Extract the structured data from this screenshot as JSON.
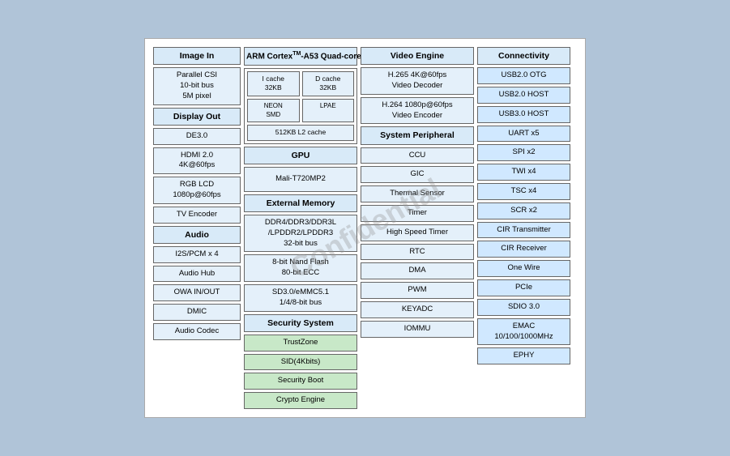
{
  "watermark": "Confidential",
  "col1": {
    "header1": "Image In",
    "parallel_csi": "Parallel CSI\n10-bit bus\n5M pixel",
    "header2": "Display Out",
    "de30": "DE3.0",
    "hdmi": "HDMI 2.0\n4K@60fps",
    "rgb_lcd": "RGB LCD\n1080p@60fps",
    "tv_encoder": "TV Encoder",
    "header3": "Audio",
    "i2s": "I2S/PCM x 4",
    "audio_hub": "Audio Hub",
    "owa": "OWA IN/OUT",
    "dmic": "DMIC",
    "audio_codec": "Audio Codec"
  },
  "col2": {
    "arm_title": "ARM CortexᵀM – A53  Quad-core",
    "icache": "I cache\n32KB",
    "dcache": "D cache\n32KB",
    "neon_smd": "NEON\nSMD",
    "lpae": "LPAE",
    "l2": "512KB L2 cache",
    "gpu_header": "GPU",
    "mali": "Mali-T720MP2",
    "ext_mem_header": "External Memory",
    "ddr": "DDR4/DDR3/DDR3L\n/LPDDR2/LPDDR3\n32-bit bus",
    "nand": "8-bit Nand Flash\n80-bit ECC",
    "sd": "SD3.0/eMMC5.1\n1/4/8-bit bus",
    "sec_header": "Security System",
    "trustzone": "TrustZone",
    "sid": "SID(4Kbits)",
    "secboot": "Security Boot",
    "crypto": "Crypto Engine"
  },
  "col3": {
    "sys_peripheral": "System Peripheral",
    "ccu": "CCU",
    "gic": "GIC",
    "thermal": "Thermal Sensor",
    "timer": "Timer",
    "high_speed_timer": "High Speed Timer",
    "rtc": "RTC",
    "dma": "DMA",
    "pwm": "PWM",
    "keyadc": "KEYADC",
    "iommu": "IOMMU",
    "video_engine": "Video Engine",
    "h265": "H.265 4K@60fps\nVideo Decoder",
    "h264": "H.264 1080p@60fps\nVideo Encoder"
  },
  "col4": {
    "connectivity": "Connectivity",
    "usb2otg": "USB2.0 OTG",
    "usb2host": "USB2.0 HOST",
    "usb3host": "USB3.0 HOST",
    "uart": "UART x5",
    "spi": "SPI x2",
    "twi": "TWI x4",
    "tsc": "TSC x4",
    "scr": "SCR x2",
    "cir_tx": "CIR Transmitter",
    "cir_rx": "CIR Receiver",
    "one_wire": "One Wire",
    "pcie": "PCIe",
    "sdio": "SDIO 3.0",
    "emac": "EMAC\n10/100/1000MHz",
    "ephy": "EPHY"
  }
}
